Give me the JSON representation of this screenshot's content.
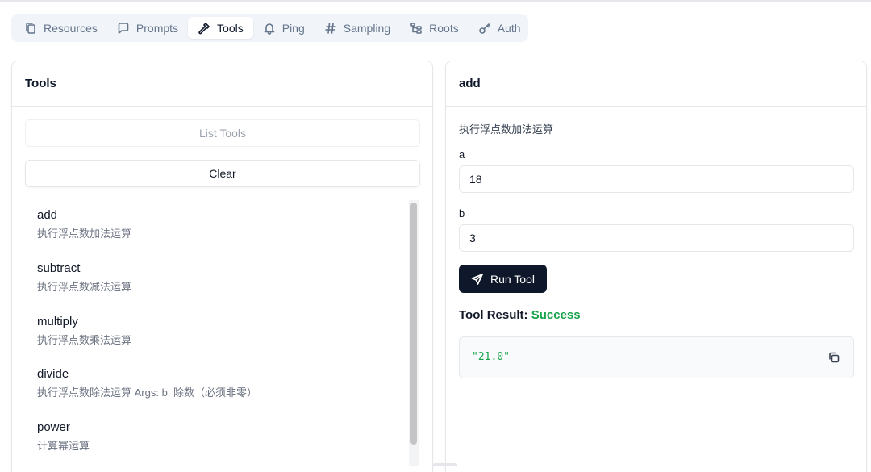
{
  "tabs": [
    {
      "label": "Resources",
      "icon": "files-icon"
    },
    {
      "label": "Prompts",
      "icon": "message-square-icon"
    },
    {
      "label": "Tools",
      "icon": "hammer-icon",
      "active": true
    },
    {
      "label": "Ping",
      "icon": "bell-icon"
    },
    {
      "label": "Sampling",
      "icon": "hash-icon"
    },
    {
      "label": "Roots",
      "icon": "folder-tree-icon"
    },
    {
      "label": "Auth",
      "icon": "key-icon"
    }
  ],
  "tools_panel": {
    "title": "Tools",
    "list_button": "List Tools",
    "clear_button": "Clear",
    "items": [
      {
        "name": "add",
        "desc": "执行浮点数加法运算"
      },
      {
        "name": "subtract",
        "desc": "执行浮点数减法运算"
      },
      {
        "name": "multiply",
        "desc": "执行浮点数乘法运算"
      },
      {
        "name": "divide",
        "desc": "执行浮点数除法运算 Args: b: 除数（必须非零）"
      },
      {
        "name": "power",
        "desc": "计算幂运算"
      }
    ]
  },
  "detail_panel": {
    "title": "add",
    "description": "执行浮点数加法运算",
    "params": [
      {
        "label": "a",
        "value": "18"
      },
      {
        "label": "b",
        "value": "3"
      }
    ],
    "run_button": "Run Tool",
    "result_label": "Tool Result:",
    "result_status": "Success",
    "result_value": "\"21.0\""
  },
  "colors": {
    "accent": "#0f172a",
    "success": "#16a34a"
  }
}
